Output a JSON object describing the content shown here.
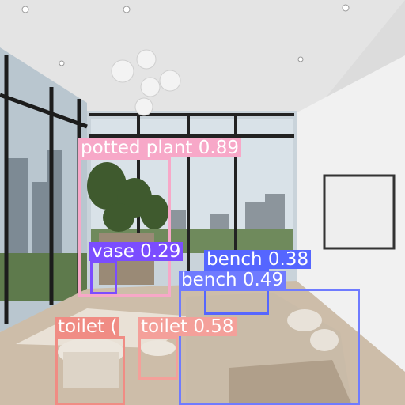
{
  "detections": [
    {
      "label": "potted plant 0.89",
      "color": "#f7a8c8"
    },
    {
      "label": "vase 0.29",
      "color": "#7b4dff"
    },
    {
      "label": "bench 0.38",
      "color": "#5566ff"
    },
    {
      "label": "bench 0.49",
      "color": "#6f7bff"
    },
    {
      "label": "toilet 0.58",
      "color": "#f4a09a"
    },
    {
      "label": "toilet (",
      "color": "#f08c84"
    }
  ]
}
